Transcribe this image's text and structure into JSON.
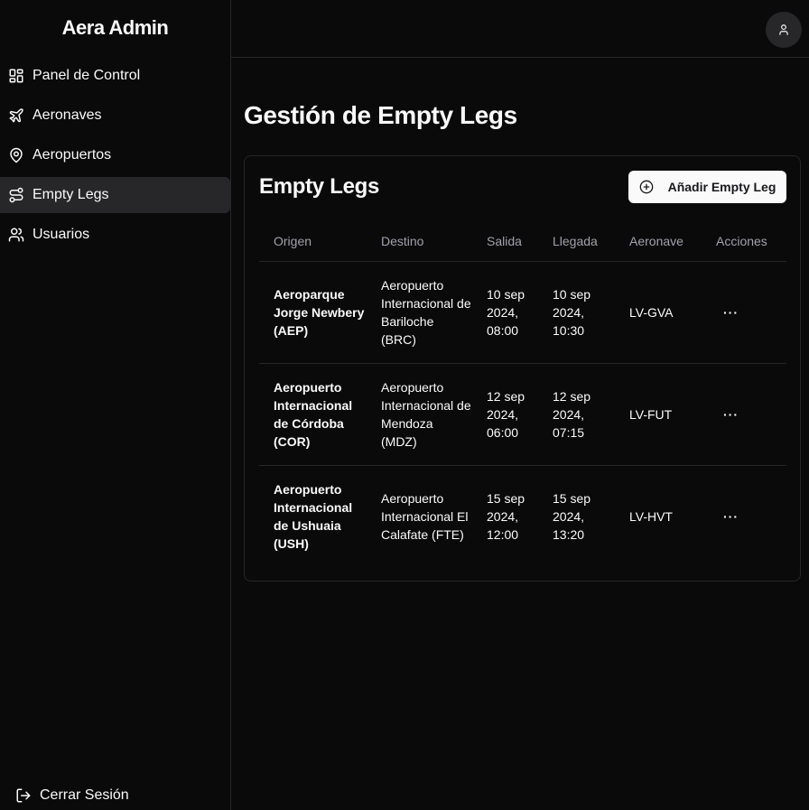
{
  "app": {
    "brand": "Aera Admin"
  },
  "sidebar": {
    "items": [
      {
        "label": "Panel de Control",
        "icon": "dashboard-icon",
        "active": false
      },
      {
        "label": "Aeronaves",
        "icon": "plane-icon",
        "active": false
      },
      {
        "label": "Aeropuertos",
        "icon": "map-pin-icon",
        "active": false
      },
      {
        "label": "Empty Legs",
        "icon": "route-icon",
        "active": true
      },
      {
        "label": "Usuarios",
        "icon": "users-icon",
        "active": false
      }
    ],
    "logout_label": "Cerrar Sesión"
  },
  "header": {
    "avatar_icon": "user-icon"
  },
  "main": {
    "title": "Gestión de Empty Legs",
    "card": {
      "title": "Empty Legs",
      "add_button": "Añadir Empty Leg",
      "columns": [
        "Origen",
        "Destino",
        "Salida",
        "Llegada",
        "Aeronave",
        "Acciones"
      ],
      "rows": [
        {
          "origin": "Aeroparque Jorge Newbery (AEP)",
          "destination": "Aeropuerto Internacional de Bariloche (BRC)",
          "departure": "10 sep 2024, 08:00",
          "arrival": "10 sep 2024, 10:30",
          "aircraft": "LV-GVA",
          "actions": "···"
        },
        {
          "origin": "Aeropuerto Internacional de Córdoba (COR)",
          "destination": "Aeropuerto Internacional de Mendoza (MDZ)",
          "departure": "12 sep 2024, 06:00",
          "arrival": "12 sep 2024, 07:15",
          "aircraft": "LV-FUT",
          "actions": "···"
        },
        {
          "origin": "Aeropuerto Internacional de Ushuaia (USH)",
          "destination": "Aeropuerto Internacional El Calafate (FTE)",
          "departure": "15 sep 2024, 12:00",
          "arrival": "15 sep 2024, 13:20",
          "aircraft": "LV-HVT",
          "actions": "···"
        }
      ]
    }
  },
  "colors": {
    "background": "#0a0a0b",
    "border": "#27272a",
    "active": "#27272a",
    "muted": "#a1a1aa"
  }
}
